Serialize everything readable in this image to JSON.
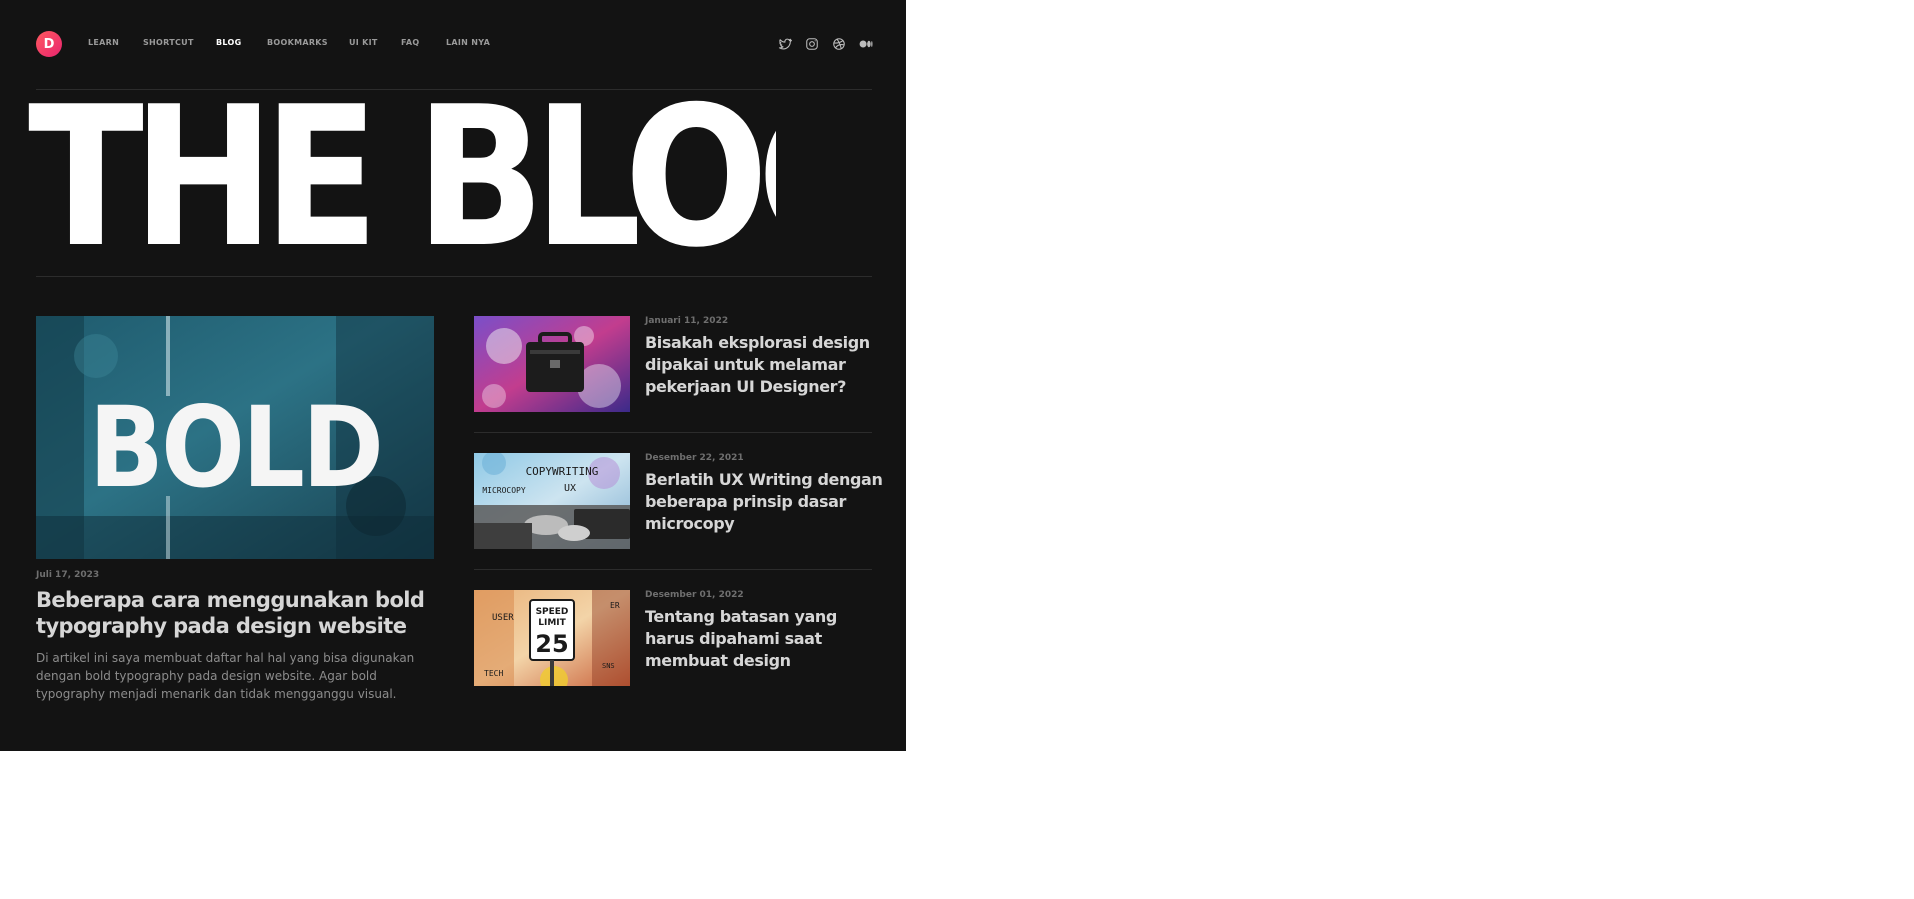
{
  "brand": {
    "logo_letter": "D",
    "accent": "#f53d6e"
  },
  "nav": {
    "items": [
      {
        "label": "LEARN",
        "active": false
      },
      {
        "label": "SHORTCUT",
        "active": false
      },
      {
        "label": "BLOG",
        "active": true
      },
      {
        "label": "BOOKMARKS",
        "active": false
      },
      {
        "label": "UI KIT",
        "active": false
      },
      {
        "label": "FAQ",
        "active": false
      },
      {
        "label": "LAIN NYA",
        "active": false
      }
    ],
    "social": [
      "twitter-icon",
      "instagram-icon",
      "dribbble-icon",
      "medium-icon"
    ]
  },
  "hero": {
    "title": "THE BLOG"
  },
  "featured": {
    "image_text": "BOLD",
    "date": "Juli 17, 2023",
    "title": "Beberapa cara menggunakan bold typography pada design website",
    "description": "Di artikel ini saya membuat daftar hal hal yang bisa digunakan dengan bold typography pada design website. Agar bold typography menjadi menarik dan tidak mengganggu visual."
  },
  "posts": [
    {
      "date": "Januari 11, 2022",
      "title": "Bisakah eksplorasi design dipakai untuk melamar pekerjaan UI Designer?"
    },
    {
      "date": "Desember 22, 2021",
      "title": "Berlatih UX Writing dengan beberapa prinsip dasar microcopy",
      "image_text": {
        "line1": "COPYWRITING",
        "line2": "UX",
        "line3": "MICROCOPY"
      }
    },
    {
      "date": "Desember 01, 2022",
      "title": "Tentang batasan yang harus dipahami saat membuat design",
      "image_text": {
        "sign1": "SPEED",
        "sign2": "LIMIT",
        "sign3": "25",
        "w1": "USER",
        "w2": "TECH",
        "w3": "SNS",
        "w4": "ER"
      }
    }
  ],
  "colors": {
    "background": "#131313",
    "text": "#ffffff",
    "muted": "#9a9a9a",
    "divider": "#2c2c2c"
  }
}
